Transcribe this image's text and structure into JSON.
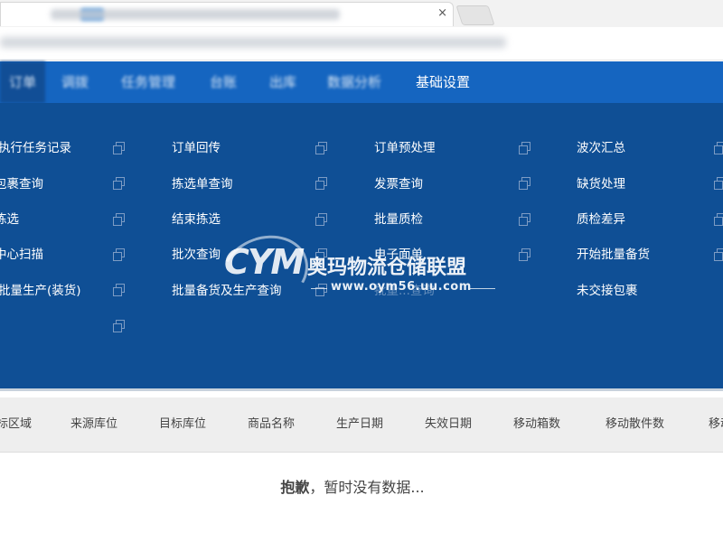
{
  "browser": {
    "close_glyph": "×"
  },
  "nav": {
    "items": [
      {
        "label": "订单",
        "blurred": true
      },
      {
        "label": "调拨",
        "blurred": true
      },
      {
        "label": "任务管理",
        "blurred": true
      },
      {
        "label": "台账",
        "blurred": true
      },
      {
        "label": "出库",
        "blurred": true
      },
      {
        "label": "数据分析",
        "blurred": true
      },
      {
        "label": "基础设置",
        "blurred": false
      }
    ]
  },
  "menu": {
    "columns": [
      [
        "执行任务记录",
        "包裹查询",
        "拣选",
        "中心扫描",
        "批量生产(装货)",
        ""
      ],
      [
        "订单回传",
        "拣选单查询",
        "结束拣选",
        "批次查询",
        "批量备货及生产查询"
      ],
      [
        "订单预处理",
        "发票查询",
        "批量质检",
        "电子面单",
        "批量...查询"
      ],
      [
        "波次汇总",
        "缺货处理",
        "质检差异",
        "开始批量备货",
        "未交接包裹"
      ]
    ]
  },
  "watermark": {
    "logo": "CYM",
    "name": "奥玛物流仓储联盟",
    "url": "www.oym56.uu.com"
  },
  "table": {
    "headers": [
      "标区域",
      "来源库位",
      "目标库位",
      "商品名称",
      "生产日期",
      "失效日期",
      "移动箱数",
      "移动散件数",
      "移动"
    ]
  },
  "empty": {
    "strong": "抱歉",
    "rest": "，暂时没有数据..."
  }
}
